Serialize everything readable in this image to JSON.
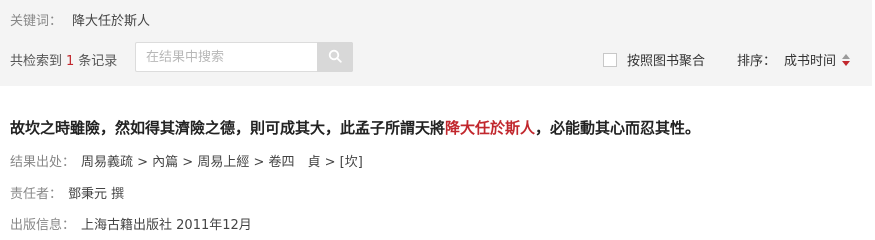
{
  "keyword": {
    "label": "关键词：",
    "value": "降大任於斯人"
  },
  "summary": {
    "prefix": "共检索到",
    "count": "1",
    "suffix": "条记录"
  },
  "search": {
    "placeholder": "在结果中搜索",
    "value": ""
  },
  "aggregate": {
    "label": "按照图书聚合",
    "checked": false
  },
  "sort": {
    "label": "排序：",
    "field": "成书时间"
  },
  "result": {
    "title_before": "故坎之時雖險，然如得其濟險之德，則可成其大，此孟子所謂天將",
    "title_highlight": "降大任於斯人",
    "title_after": "，必能動其心而忍其性。",
    "source_label": "结果出处：",
    "source_value": "周易義疏 > 內篇 > 周易上經 > 卷四　貞 > [坎]",
    "author_label": "责任者：",
    "author_value": "鄧秉元 撰",
    "publish_label": "出版信息：",
    "publish_value": "上海古籍出版社 2011年12月"
  },
  "colors": {
    "accent": "#c1272d",
    "panel_bg": "#f4f4f4"
  }
}
